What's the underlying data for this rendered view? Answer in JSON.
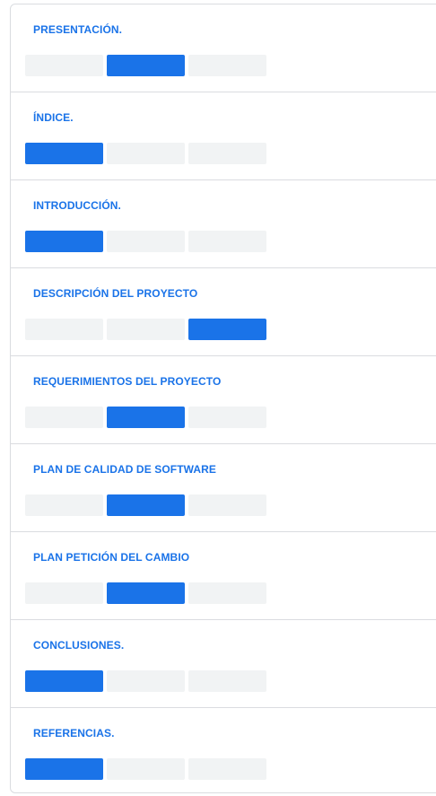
{
  "colors": {
    "accent": "#1a73e8",
    "segment_inactive": "#f1f3f4",
    "border": "#dadce0"
  },
  "sections": [
    {
      "title": "PRESENTACIÓN.",
      "segments": 3,
      "selected": 1
    },
    {
      "title": "ÍNDICE.",
      "segments": 3,
      "selected": 0
    },
    {
      "title": "INTRODUCCIÓN.",
      "segments": 3,
      "selected": 0
    },
    {
      "title": "DESCRIPCIÓN DEL PROYECTO",
      "segments": 3,
      "selected": 2
    },
    {
      "title": "REQUERIMIENTOS DEL PROYECTO",
      "segments": 3,
      "selected": 1
    },
    {
      "title": "PLAN DE CALIDAD DE SOFTWARE",
      "segments": 3,
      "selected": 1
    },
    {
      "title": "PLAN PETICIÓN DEL CAMBIO",
      "segments": 3,
      "selected": 1
    },
    {
      "title": "CONCLUSIONES.",
      "segments": 3,
      "selected": 0
    },
    {
      "title": "REFERENCIAS.",
      "segments": 3,
      "selected": 0
    }
  ]
}
